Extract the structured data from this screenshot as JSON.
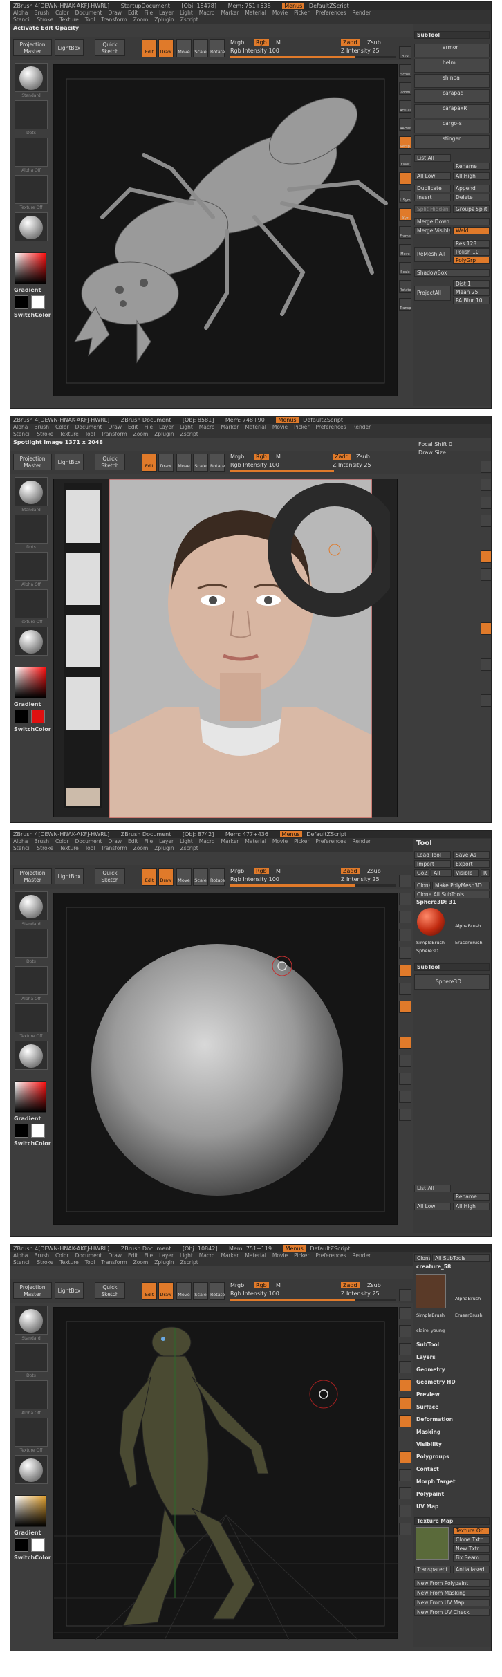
{
  "title_bar": {
    "app": "ZBrush 4[DEWN-HNAK-AKFJ-HWRL]",
    "doc": "ZBrush Document",
    "mem_btn": "Menus",
    "script": "DefaultZScript"
  },
  "menu": {
    "row1": [
      "Alpha",
      "Brush",
      "Color",
      "Document",
      "Draw",
      "Edit",
      "File",
      "Layer",
      "Light",
      "Macro",
      "Marker",
      "Material",
      "Movie",
      "Picker",
      "Preferences",
      "Render"
    ],
    "row2": [
      "Stencil",
      "Stroke",
      "Texture",
      "Tool",
      "Transform",
      "Zoom",
      "Zplugin",
      "Zscript"
    ]
  },
  "shelf": {
    "projection_master": "Projection Master",
    "lightbox": "LightBox",
    "quick_sketch": "Quick Sketch",
    "edit": "Edit",
    "draw": "Draw",
    "move": "Move",
    "scale": "Scale",
    "rotate": "Rotate",
    "mrgb": "Mrgb",
    "rgb": "Rgb",
    "m": "M",
    "rgb_intensity": "Rgb Intensity 100",
    "zadd": "Zadd",
    "zsub": "Zsub",
    "z_intensity": "Z Intensity 25"
  },
  "left": {
    "standard": "Standard",
    "dots": "Dots",
    "alpha_off": "Alpha Off",
    "texture_off": "Texture Off",
    "gradient": "Gradient",
    "switch_color": "SwitchColor"
  },
  "right_icons": [
    "BPR",
    "Scroll",
    "Zoom",
    "Actual",
    "AAHalf",
    "Persp",
    "Floor",
    "L.Sym",
    "Xyz",
    "Frame",
    "Move",
    "Scale",
    "Rotate",
    "Transp"
  ],
  "frames": [
    {
      "obj": "[Obj: 18478]",
      "mem": "Mem: 751+538",
      "doc": "StartupDocument",
      "status": "Activate Edit Opacity",
      "tool_rows": [
        "SubTool",
        "armor",
        "helm",
        "shinpa",
        "carapad",
        "carapaxR",
        "cargo-s",
        "stinger",
        "List All",
        "Rename",
        "All Low",
        "All High",
        "Duplicate",
        "Append",
        "Insert",
        "Delete",
        "Split Hidden",
        "Groups Split",
        "Merge Down",
        "Merge Visible",
        "Weld",
        "Res 128",
        "ReMesh All",
        "Polish 10",
        "PolyGrp",
        "ShadowBox",
        "ProjectAll",
        "Dist 1",
        "Mean 25",
        "PA Blur 10"
      ]
    },
    {
      "obj": "[Obj: 8581]",
      "mem": "Mem: 748+90",
      "doc": "ZBrush Document",
      "status": "Spotlight image 1371 x 2048",
      "focal": "Focal Shift 0",
      "draw_size": "Draw Size"
    },
    {
      "obj": "[Obj: 8742]",
      "mem": "Mem: 477+436",
      "doc": "ZBrush Document",
      "status": "",
      "tool_rows": [
        "Tool",
        "Load Tool",
        "Save As",
        "Import",
        "Export",
        "GoZ",
        "All",
        "Visible",
        "R",
        "Clone",
        "Make PolyMesh3D",
        "Clone All SubTools",
        "Sphere3D: 31",
        "SimpleBrush",
        "EraserBrush",
        "AlphaBrush",
        "Sphere3D",
        "SubTool",
        "Sphere3D",
        "List All",
        "Rename",
        "All Low",
        "All High"
      ]
    },
    {
      "obj": "[Obj: 10842]",
      "mem": "Mem: 751+119",
      "doc": "ZBrush Document",
      "status": "",
      "tool_rows": [
        "Clone",
        "All SubTools",
        "creature_58",
        "SimpleBrush",
        "EraserBrush",
        "AlphaBrush",
        "claire_young",
        "SubTool",
        "Layers",
        "Geometry",
        "Geometry HD",
        "Preview",
        "Surface",
        "Deformation",
        "Masking",
        "Visibility",
        "Polygroups",
        "Contact",
        "Morph Target",
        "Polypaint",
        "UV Map",
        "Texture Map",
        "Texture On",
        "Clone Txtr",
        "New Txtr",
        "Fix Seam",
        "Transparent",
        "Antialiased",
        "New From Polypaint",
        "New From Masking",
        "New From UV Map",
        "New From UV Check"
      ]
    }
  ],
  "colors": {
    "accent": "#e07a2a",
    "bg": "#3d3d3d",
    "viewport": "#151515"
  }
}
